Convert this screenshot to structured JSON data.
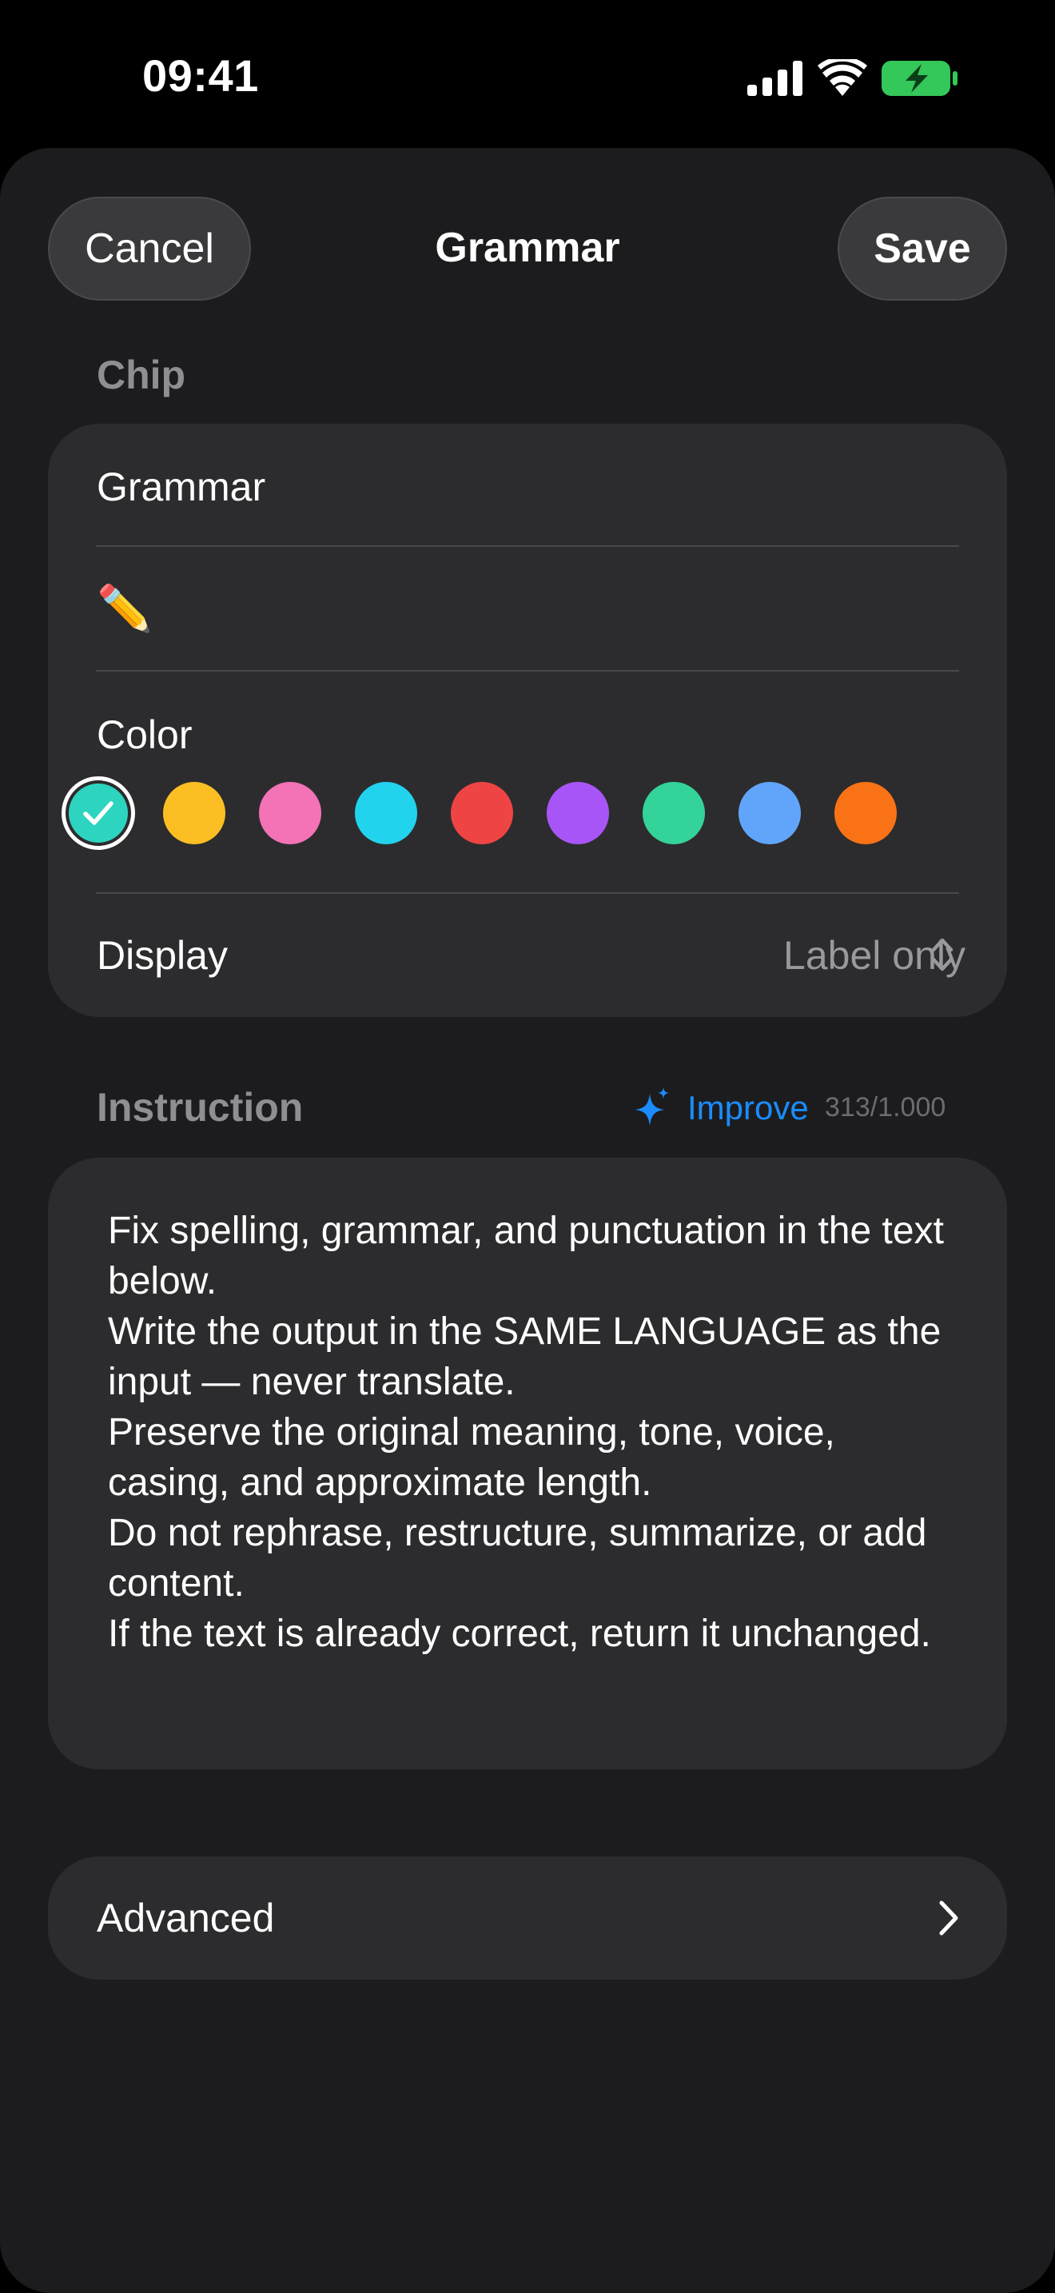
{
  "status_bar": {
    "time": "09:41"
  },
  "nav": {
    "cancel_label": "Cancel",
    "title": "Grammar",
    "save_label": "Save"
  },
  "chip": {
    "section_label": "Chip",
    "name_value": "Grammar",
    "emoji_value": "✏️",
    "color_label": "Color",
    "colors": [
      "#2dd4bf",
      "#fbbf24",
      "#f472b6",
      "#22d3ee",
      "#ef4444",
      "#a855f7",
      "#34d399",
      "#60a5fa",
      "#f97316"
    ],
    "selected_color_index": 0,
    "display_label": "Display",
    "display_value": "Label only"
  },
  "instruction": {
    "section_label": "Instruction",
    "improve_label": "Improve",
    "counter": "313/1.000",
    "text": "Fix spelling, grammar, and punctuation in the text below.\nWrite the output in the SAME LANGUAGE as the input — never translate.\nPreserve the original meaning, tone, voice, casing, and approximate length.\nDo not rephrase, restructure, summarize, or add content.\nIf the text is already correct, return it unchanged."
  },
  "advanced": {
    "label": "Advanced"
  },
  "icons": {
    "signal": "cellular-signal-icon",
    "wifi": "wifi-icon",
    "battery": "battery-charging-icon",
    "sparkle": "sparkle-icon",
    "chevron": "chevron-right-icon",
    "updown": "chevron-up-down-icon",
    "check": "checkmark-icon"
  },
  "accent": "#1a8cff"
}
